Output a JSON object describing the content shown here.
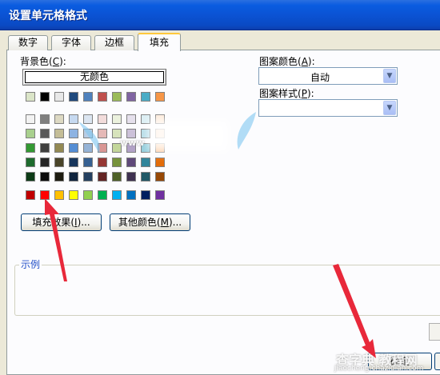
{
  "window": {
    "title": "设置单元格格式"
  },
  "tabs": [
    {
      "label": "数字",
      "active": false
    },
    {
      "label": "字体",
      "active": false
    },
    {
      "label": "边框",
      "active": false
    },
    {
      "label": "填充",
      "active": true
    }
  ],
  "fill": {
    "background_label": "背景色",
    "background_hotkey": "C",
    "no_color_label": "无颜色",
    "fill_effects_label": "填充效果",
    "fill_effects_hotkey": "I",
    "more_colors_label": "其他颜色",
    "more_colors_hotkey": "M",
    "palette_row1": [
      "#dbe5c8",
      "#000000",
      "#e8e8e8",
      "#1f497d",
      "#4f81bd",
      "#c0504d",
      "#9bbb59",
      "#8064a2",
      "#4bacc6",
      "#f79646"
    ],
    "palette_theme": [
      [
        "#f2f2f2",
        "#7f7f7f",
        "#ddd9c3",
        "#c6d9f0",
        "#dbe5f1",
        "#f2dcdb",
        "#ebf1dd",
        "#e5e0ec",
        "#dbeef3",
        "#fdeada"
      ],
      [
        "#a9d08e",
        "#595959",
        "#c4bd97",
        "#8db3e2",
        "#b8cce4",
        "#e5b9b7",
        "#d7e3bc",
        "#ccc1d9",
        "#b7dde8",
        "#fbd5b5"
      ],
      [
        "#339933",
        "#3f3f3f",
        "#938953",
        "#548dd4",
        "#95b3d7",
        "#d99694",
        "#c3d69b",
        "#b2a2c7",
        "#92cddc",
        "#fac08f"
      ],
      [
        "#1e6b2e",
        "#262626",
        "#494429",
        "#17365d",
        "#366092",
        "#953734",
        "#76923c",
        "#5f497a",
        "#31859b",
        "#e36c09"
      ],
      [
        "#0d3b17",
        "#0c0c0c",
        "#1d1b10",
        "#0f243e",
        "#244061",
        "#632423",
        "#4f6128",
        "#3f3151",
        "#205867",
        "#974806"
      ]
    ],
    "palette_standard": [
      "#c00000",
      "#ff0000",
      "#ffc000",
      "#ffff00",
      "#92d050",
      "#00b050",
      "#00b0f0",
      "#0070c0",
      "#002060",
      "#7030a0"
    ],
    "pattern_color_label": "图案颜色",
    "pattern_color_hotkey": "A",
    "pattern_color_value": "自动",
    "pattern_style_label": "图案样式",
    "pattern_style_hotkey": "P",
    "pattern_style_value": "",
    "sample_label": "示例"
  },
  "footer": {
    "ok_label": "确定"
  },
  "watermark": {
    "text": "查字典 教程网",
    "sub": "jiaocheng.chazidian.com",
    "mid": "www"
  },
  "colors": {
    "titlebar": "#0b53d4",
    "arrow": "#e8283a",
    "tab_highlight": "#ffc83c"
  }
}
